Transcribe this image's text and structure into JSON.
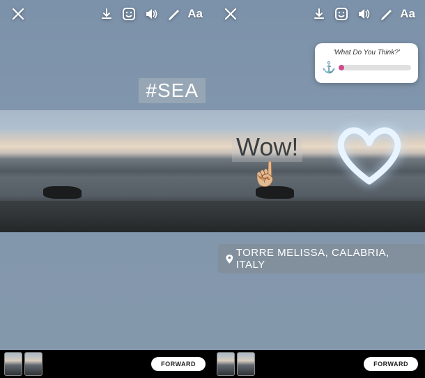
{
  "toolbar": {
    "text_label": "Aa"
  },
  "left": {
    "hashtag": "#SEA",
    "forward_label": "FORWARD"
  },
  "right": {
    "poll": {
      "title": "'What Do You Think?'",
      "emoji": "⚓"
    },
    "wow_text": "Wow!",
    "finger_emoji": "☝🏼",
    "location_text": "TORRE MELISSA, CALABRIA, ITALY",
    "forward_label": "FORWARD"
  }
}
